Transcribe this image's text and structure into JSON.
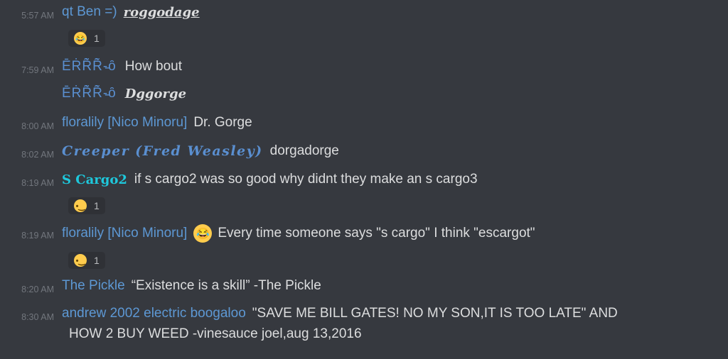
{
  "messages": [
    {
      "time": "5:57 AM",
      "user": "qt Ben =)",
      "text": "roggodage",
      "reaction": {
        "emoji": "joy",
        "count": "1"
      }
    },
    {
      "time": "7:59 AM",
      "user": "ĒṘṘ̃Ṙ̃-̵ȏ",
      "text": "How bout"
    },
    {
      "user": "ĒṘṘ̃Ṙ̃-̵ȏ",
      "text": "Dggorge"
    },
    {
      "time": "8:00 AM",
      "user": "floralily [Nico Minoru]",
      "text": "Dr. Gorge"
    },
    {
      "time": "8:02 AM",
      "user": "Creeper (Fred Weasley)",
      "text": "dorgadorge"
    },
    {
      "time": "8:19 AM",
      "user": "S Cargo2",
      "text": "if s cargo2 was so good why didnt they make an s cargo3",
      "reaction": {
        "emoji": "snail-face",
        "count": "1"
      }
    },
    {
      "time": "8:19 AM",
      "user": "floralily [Nico Minoru]",
      "text": "Every time someone says \"s cargo\" I think \"escargot\"",
      "reaction": {
        "emoji": "snail-face",
        "count": "1"
      }
    },
    {
      "time": "8:20 AM",
      "user": "The Pickle",
      "text": "“Existence is a skill” -The Pickle"
    },
    {
      "time": "8:30 AM",
      "user": "andrew 2002 electric boogaloo",
      "text": "\"SAVE ME BILL GATES!  NO MY SON,IT IS TOO LATE\" AND",
      "text_line2": "HOW 2 BUY WEED  -vinesauce joel,aug 13,2016"
    }
  ],
  "colors": {
    "background": "#36393f",
    "username": "#5d98d4",
    "cyan_username": "#1ec8dc",
    "timestamp": "#72767d"
  }
}
